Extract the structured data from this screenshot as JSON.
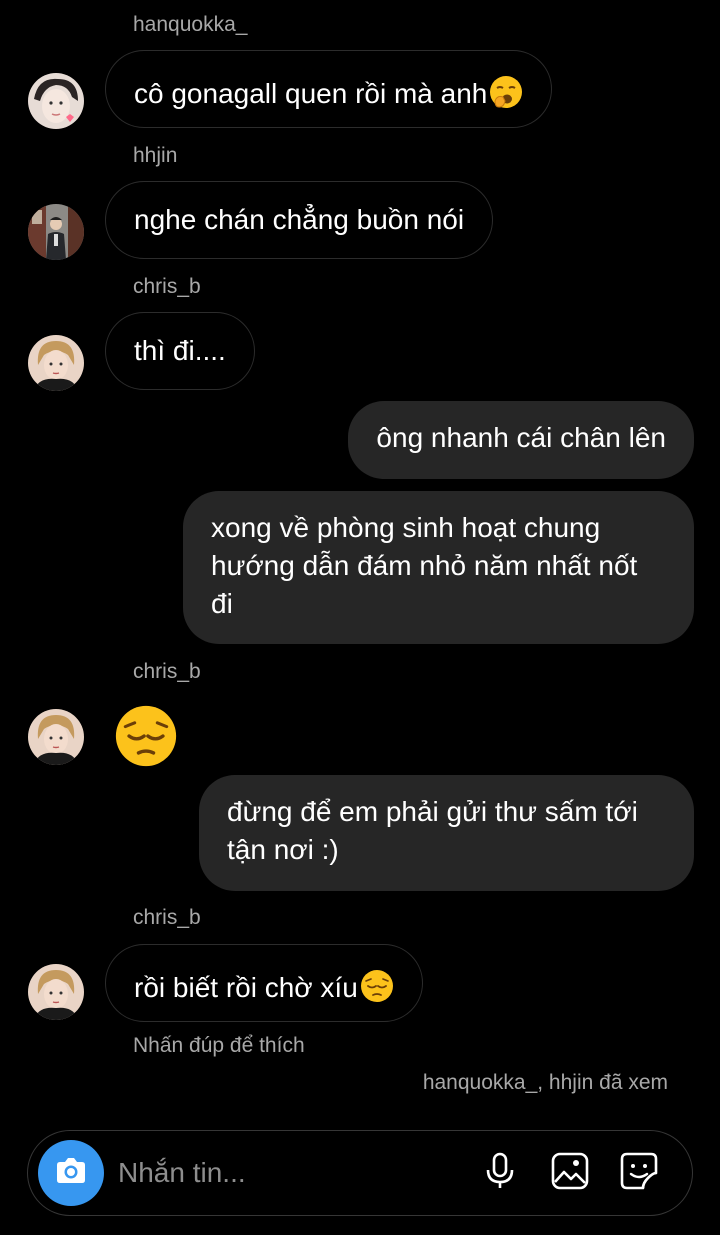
{
  "thread": [
    {
      "sender": "hanquokka_",
      "text": "cô gonagall quen rồi mà anh",
      "emoji": "yawning-face"
    },
    {
      "sender": "hhjin",
      "text": "nghe chán chẳng buồn nói"
    },
    {
      "sender": "chris_b",
      "text": "thì đi...."
    },
    {
      "text": "ông nhanh cái chân lên"
    },
    {
      "text": "xong về phòng sinh hoạt chung hướng dẫn đám nhỏ năm nhất nốt đi"
    },
    {
      "sender": "chris_b",
      "emoji": "pensive-face"
    },
    {
      "text": "đừng để em phải gửi thư sấm tới tận nơi :)"
    },
    {
      "sender": "chris_b",
      "text": "rồi biết rồi chờ xíu",
      "emoji": "pensive-face"
    }
  ],
  "like_hint": "Nhấn đúp để thích",
  "seen_receipt": "hanquokka_, hhjin đã xem",
  "composer": {
    "placeholder": "Nhắn tin...",
    "accent_color": "#3797f0",
    "icons": [
      "camera-icon",
      "microphone-icon",
      "gallery-icon",
      "sticker-icon"
    ]
  }
}
